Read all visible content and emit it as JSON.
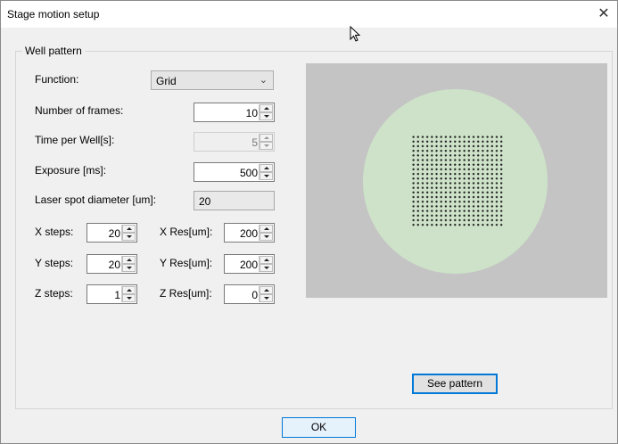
{
  "window": {
    "title": "Stage motion setup",
    "close_glyph": "✕"
  },
  "group": {
    "label": "Well pattern"
  },
  "fields": {
    "function_label": "Function:",
    "function_value": "Grid",
    "frames_label": "Number of frames:",
    "frames_value": "10",
    "time_label": "Time per Well[s]:",
    "time_value": "5",
    "exposure_label": "Exposure [ms]:",
    "exposure_value": "500",
    "laser_label": "Laser spot diameter [um]:",
    "laser_value": "20",
    "xsteps_label": "X steps:",
    "xsteps_value": "20",
    "ysteps_label": "Y steps:",
    "ysteps_value": "20",
    "zsteps_label": "Z steps:",
    "zsteps_value": "1",
    "xres_label": "X Res[um]:",
    "xres_value": "200",
    "yres_label": "Y Res[um]:",
    "yres_value": "200",
    "zres_label": "Z Res[um]:",
    "zres_value": "0"
  },
  "buttons": {
    "see_pattern": "See pattern",
    "ok": "OK"
  },
  "preview": {
    "background": "#c4c4c4",
    "well_color": "#cde2c8",
    "dot_color": "#222222"
  }
}
